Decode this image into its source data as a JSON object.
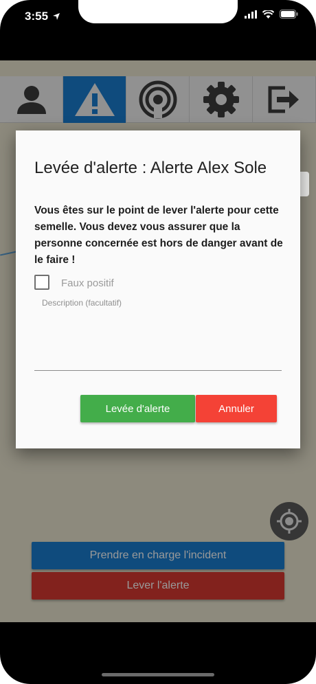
{
  "status_bar": {
    "time": "3:55",
    "icons": [
      "location-arrow-icon",
      "signal-icon",
      "wifi-icon",
      "battery-icon"
    ]
  },
  "toolbar": {
    "items": [
      {
        "icon": "user-icon",
        "active": false
      },
      {
        "icon": "warning-icon",
        "active": true
      },
      {
        "icon": "radar-icon",
        "active": false
      },
      {
        "icon": "gear-icon",
        "active": false
      },
      {
        "icon": "logout-icon",
        "active": false
      }
    ]
  },
  "main": {
    "take_incident_label": "Prendre en charge l'incident",
    "lift_alert_label": "Lever l'alerte"
  },
  "dialog": {
    "title": "Levée d'alerte : Alerte Alex Sole",
    "message": "Vous êtes sur le point de lever l'alerte pour cette semelle. Vous devez vous assurer que la personne concernée est hors de danger avant de le faire !",
    "false_positive_label": "Faux positif",
    "false_positive_checked": false,
    "description_label": "Description (facultatif)",
    "description_value": "",
    "confirm_label": "Levée d'alerte",
    "cancel_label": "Annuler"
  },
  "colors": {
    "primary": "#1a7ed0",
    "danger": "#d93a31",
    "confirm": "#43ad4a",
    "cancel": "#f44236",
    "map_background": "#ebe7d1"
  }
}
